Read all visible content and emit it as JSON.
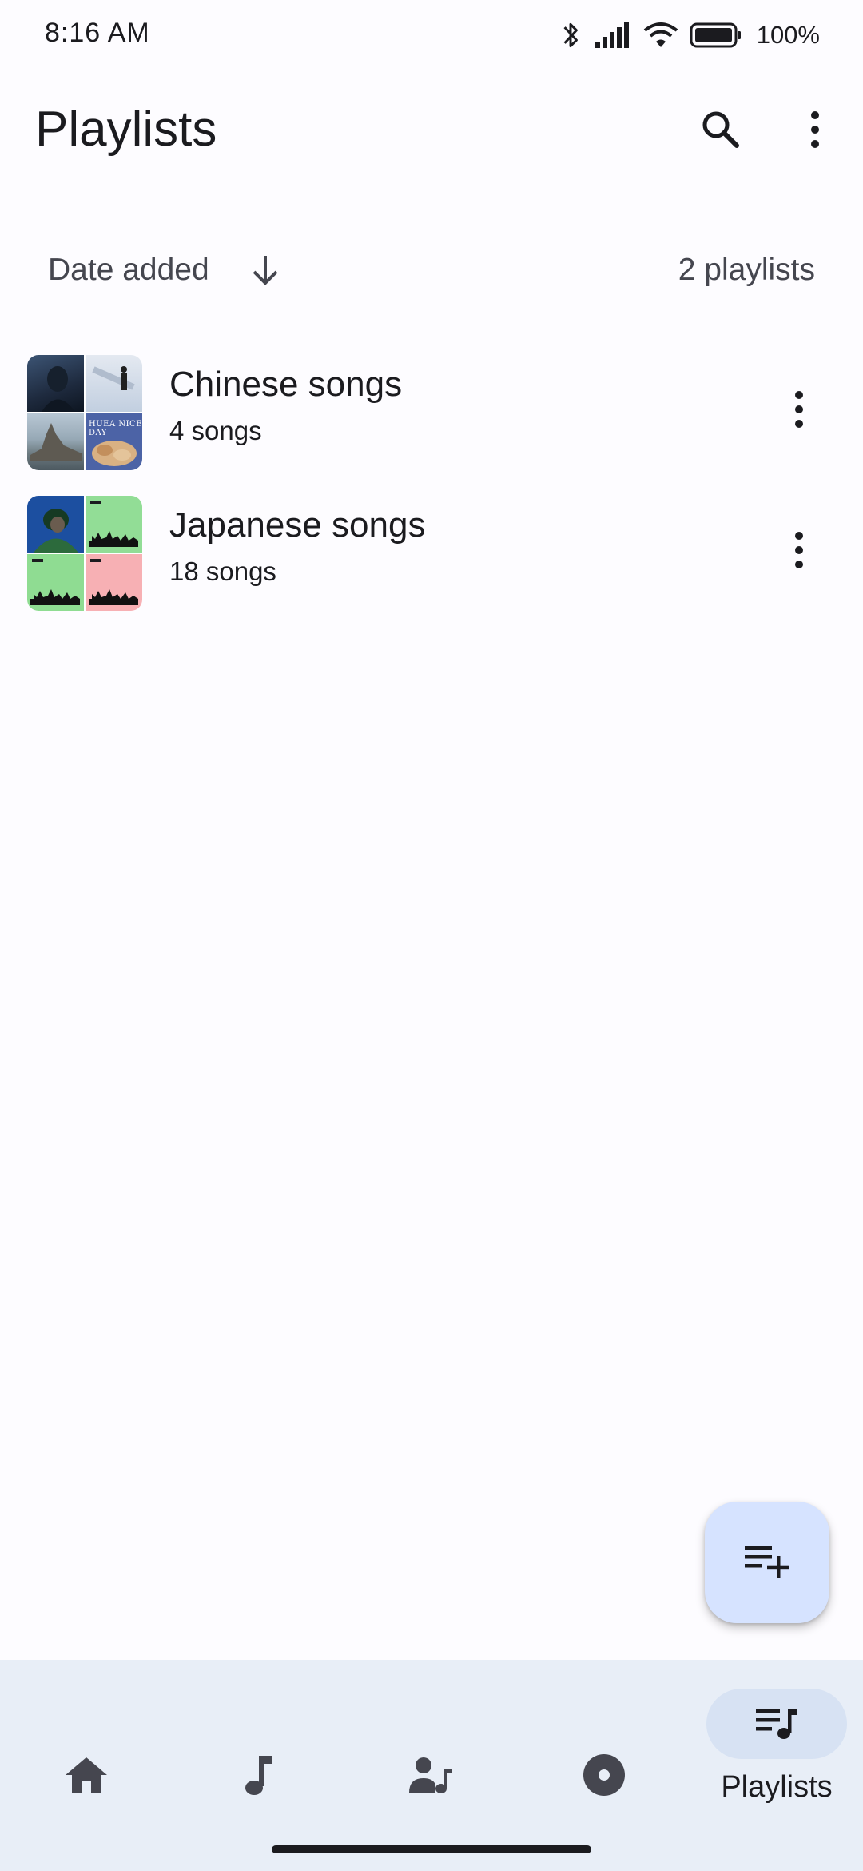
{
  "status_bar": {
    "time": "8:16 AM",
    "battery": "100%",
    "icons": [
      "bluetooth-icon",
      "signal-icon",
      "wifi-icon",
      "battery-icon"
    ]
  },
  "app_bar": {
    "title": "Playlists",
    "actions": [
      "search-icon",
      "more-vert-icon"
    ]
  },
  "sort": {
    "label": "Date added",
    "direction_icon": "arrow-down-icon",
    "count": "2 playlists"
  },
  "playlists": [
    {
      "name": "Chinese songs",
      "count": "4 songs",
      "cover_text": "HUEA NICE DAY",
      "cover_colors": [
        "#2a3b55",
        "#c9d4e4",
        "#7f96ac",
        "#5a6fa8"
      ]
    },
    {
      "name": "Japanese songs",
      "count": "18 songs",
      "cover_colors": [
        "#1c4fa0",
        "#92dd96",
        "#8fdc92",
        "#f7b0b4"
      ]
    }
  ],
  "fab": {
    "icon": "playlist-add-icon"
  },
  "bottom_nav": {
    "items": [
      {
        "icon": "home-icon",
        "label": "",
        "active": false
      },
      {
        "icon": "music-note-icon",
        "label": "",
        "active": false
      },
      {
        "icon": "artist-icon",
        "label": "",
        "active": false
      },
      {
        "icon": "album-icon",
        "label": "",
        "active": false
      },
      {
        "icon": "queue-music-icon",
        "label": "Playlists",
        "active": true
      }
    ]
  },
  "colors": {
    "background": "#fdfcff",
    "fab": "#d6e3ff",
    "nav_background": "#e8eef7",
    "nav_active_pill": "#d7e2f3",
    "text_primary": "#1b1b1f",
    "text_secondary": "#45464f"
  }
}
